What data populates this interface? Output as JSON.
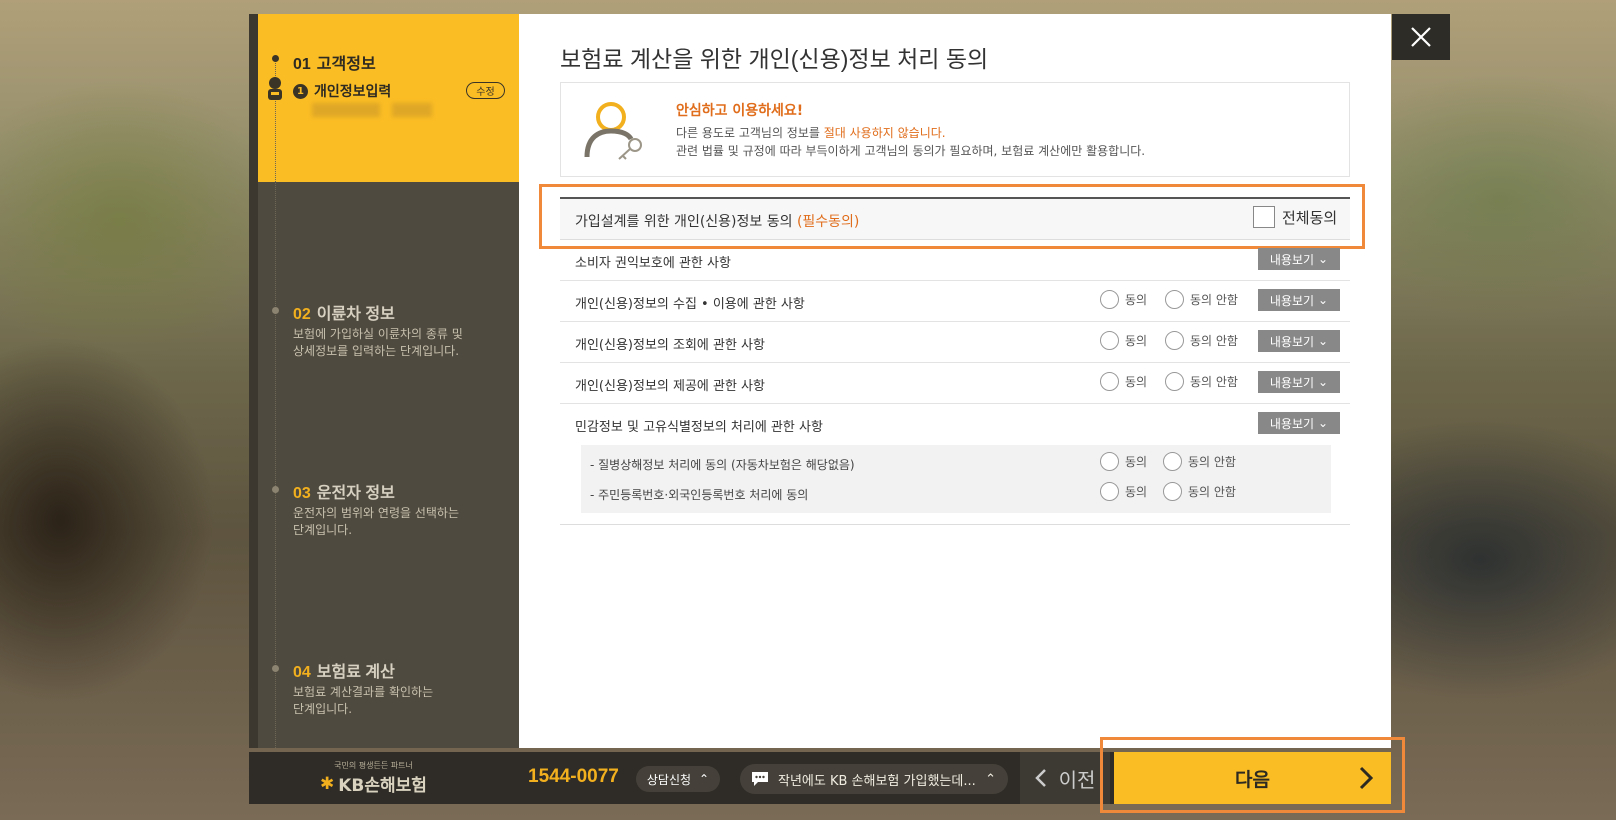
{
  "steps": [
    {
      "num": "01",
      "title": "고객정보",
      "substep_num": "1",
      "substep_label": "개인정보입력",
      "edit_label": "수정"
    },
    {
      "num": "02",
      "title": "이륜차 정보",
      "desc_1": "보험에 가입하실 이륜차의 종류 및",
      "desc_2": "상세정보를 입력하는 단계입니다."
    },
    {
      "num": "03",
      "title": "운전자 정보",
      "desc_1": "운전자의 범위와 연령을 선택하는",
      "desc_2": "단계입니다."
    },
    {
      "num": "04",
      "title": "보험료 계산",
      "desc_1": "보험료 계산결과를 확인하는",
      "desc_2": "단계입니다."
    }
  ],
  "main": {
    "title": "보험료 계산을 위한 개인(신용)정보 처리 동의",
    "notice": {
      "head": "안심하고 이용하세요!",
      "line1_pre": "다른 용도로 고객님의 정보를 ",
      "line1_hl": "절대 사용하지 않습니다.",
      "line2": "관련 법률 및 규정에 따라 부득이하게 고객님의 동의가 필요하며, 보험료 계산에만 활용합니다."
    },
    "agree_header": {
      "label": "가입설계를 위한 개인(신용)정보 동의 ",
      "required": "(필수동의)",
      "all_agree": "전체동의"
    },
    "rows": [
      {
        "label": "소비자 권익보호에 관한 사항"
      },
      {
        "label": "개인(신용)정보의 수집 • 이용에 관한 사항"
      },
      {
        "label": "개인(신용)정보의 조회에 관한 사항"
      },
      {
        "label": "개인(신용)정보의 제공에 관한 사항"
      },
      {
        "label": "민감정보 및 고유식별정보의 처리에 관한 사항"
      }
    ],
    "sub_rows": [
      {
        "label": "- 질병상해정보 처리에 동의 (자동차보험은 해당없음)"
      },
      {
        "label": "- 주민등록번호·외국인등록번호 처리에 동의"
      }
    ],
    "agree_label": "동의",
    "disagree_label": "동의 안함",
    "view_label": "내용보기"
  },
  "bottom": {
    "slogan": "국민의 평생든든 파트너",
    "brand": "KB손해보험",
    "phone": "1544-0077",
    "consult": "상담신청",
    "chat": "작년에도 KB 손해보험 가입했는데...",
    "prev": "이전",
    "next": "다음"
  },
  "colors": {
    "accent": "#fbbd24",
    "highlight": "#e06d1b",
    "sidebar": "#4f4a3f"
  }
}
